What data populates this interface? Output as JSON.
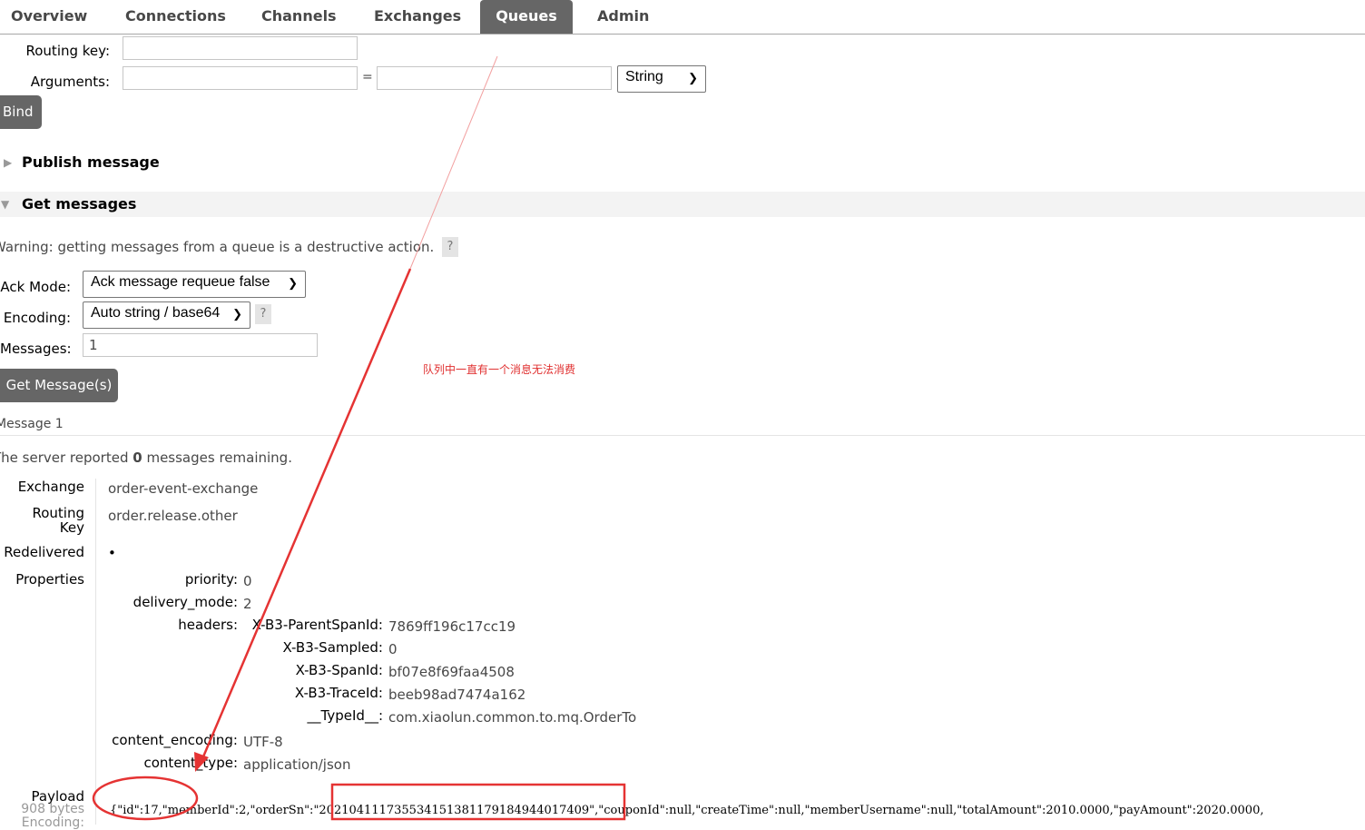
{
  "nav": {
    "tabs": [
      {
        "label": "Overview"
      },
      {
        "label": "Connections"
      },
      {
        "label": "Channels"
      },
      {
        "label": "Exchanges"
      },
      {
        "label": "Queues",
        "active": true
      },
      {
        "label": "Admin"
      }
    ]
  },
  "bind": {
    "routing_key_label": "Routing key:",
    "routing_key_value": "",
    "arguments_label": "Arguments:",
    "equals": "=",
    "arg_key_value": "",
    "arg_val_value": "",
    "arg_type": "String",
    "bind_button": "Bind"
  },
  "publish": {
    "title": "Publish message"
  },
  "get": {
    "title": "Get messages",
    "warning": "Warning: getting messages from a queue is a destructive action.",
    "help": "?",
    "ack_label": "Ack Mode:",
    "ack_value": "Ack message requeue false",
    "encoding_label": "Encoding:",
    "encoding_value": "Auto string / base64",
    "messages_label": "Messages:",
    "messages_value": "1",
    "button": "Get Message(s)"
  },
  "annotation": {
    "text": "队列中一直有一个消息无法消费",
    "color": "#e03030"
  },
  "result": {
    "message_title": "Message 1",
    "server_text_pre": "The server reported ",
    "server_count": "0",
    "server_text_post": " messages remaining.",
    "exchange_label": "Exchange",
    "exchange_value": "order-event-exchange",
    "routing_label_1": "Routing",
    "routing_label_2": "Key",
    "routing_value": "order.release.other",
    "redelivered_label": "Redelivered",
    "redelivered_value": "•",
    "properties_label": "Properties",
    "props": {
      "priority_label": "priority:",
      "priority_value": "0",
      "delivery_label": "delivery_mode:",
      "delivery_value": "2",
      "headers_label": "headers:",
      "headers": [
        {
          "key": "X-B3-ParentSpanId:",
          "value": "7869ff196c17cc19"
        },
        {
          "key": "X-B3-Sampled:",
          "value": "0"
        },
        {
          "key": "X-B3-SpanId:",
          "value": "bf07e8f69faa4508"
        },
        {
          "key": "X-B3-TraceId:",
          "value": "beeb98ad7474a162"
        },
        {
          "key": "__TypeId__:",
          "value": "com.xiaolun.common.to.mq.OrderTo"
        }
      ],
      "encoding_label": "content_encoding:",
      "encoding_value": "UTF-8",
      "type_label": "content_type:",
      "type_value": "application/json"
    },
    "payload_label": "Payload",
    "payload_size": "908 bytes",
    "payload_encoding": "Encoding:",
    "payload_pre": "{\"id\":17,\"memberId\":2,\"orderSn\":",
    "payload_highlight": "\"202104111735534151381179184944017409\"",
    "payload_post": ",\"couponId\":null,\"createTime\":null,\"memberUsername\":null,\"totalAmount\":2010.0000,\"payAmount\":2020.0000,"
  },
  "colors": {
    "tab_active": "#666666",
    "button": "#666666",
    "markup": "#e53333"
  }
}
